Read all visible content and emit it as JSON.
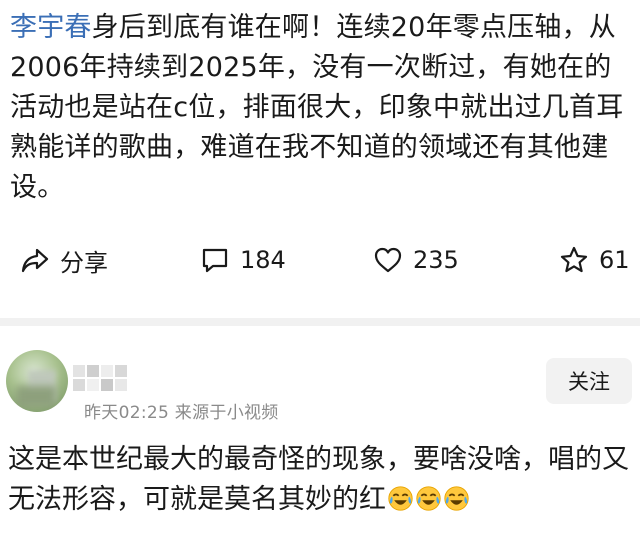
{
  "post": {
    "mention": "李宇春",
    "body": "身后到底有谁在啊！连续20年零点压轴，从2006年持续到2025年，没有一次断过，有她在的活动也是站在c位，排面很大，印象中就出过几首耳熟能详的歌曲，难道在我不知道的领域还有其他建设。"
  },
  "actions": {
    "share_label": "分享",
    "comments_count": "184",
    "likes_count": "235",
    "favorites_count": "61"
  },
  "comment": {
    "meta": "昨天02:25 来源于小视频",
    "follow_label": "关注",
    "text": "这是本世纪最大的最奇怪的现象，要啥没啥，唱的又无法形容，可就是莫名其妙的红",
    "emoji_names": [
      "crying-laughing-emoji",
      "crying-laughing-emoji",
      "crying-laughing-emoji"
    ]
  }
}
